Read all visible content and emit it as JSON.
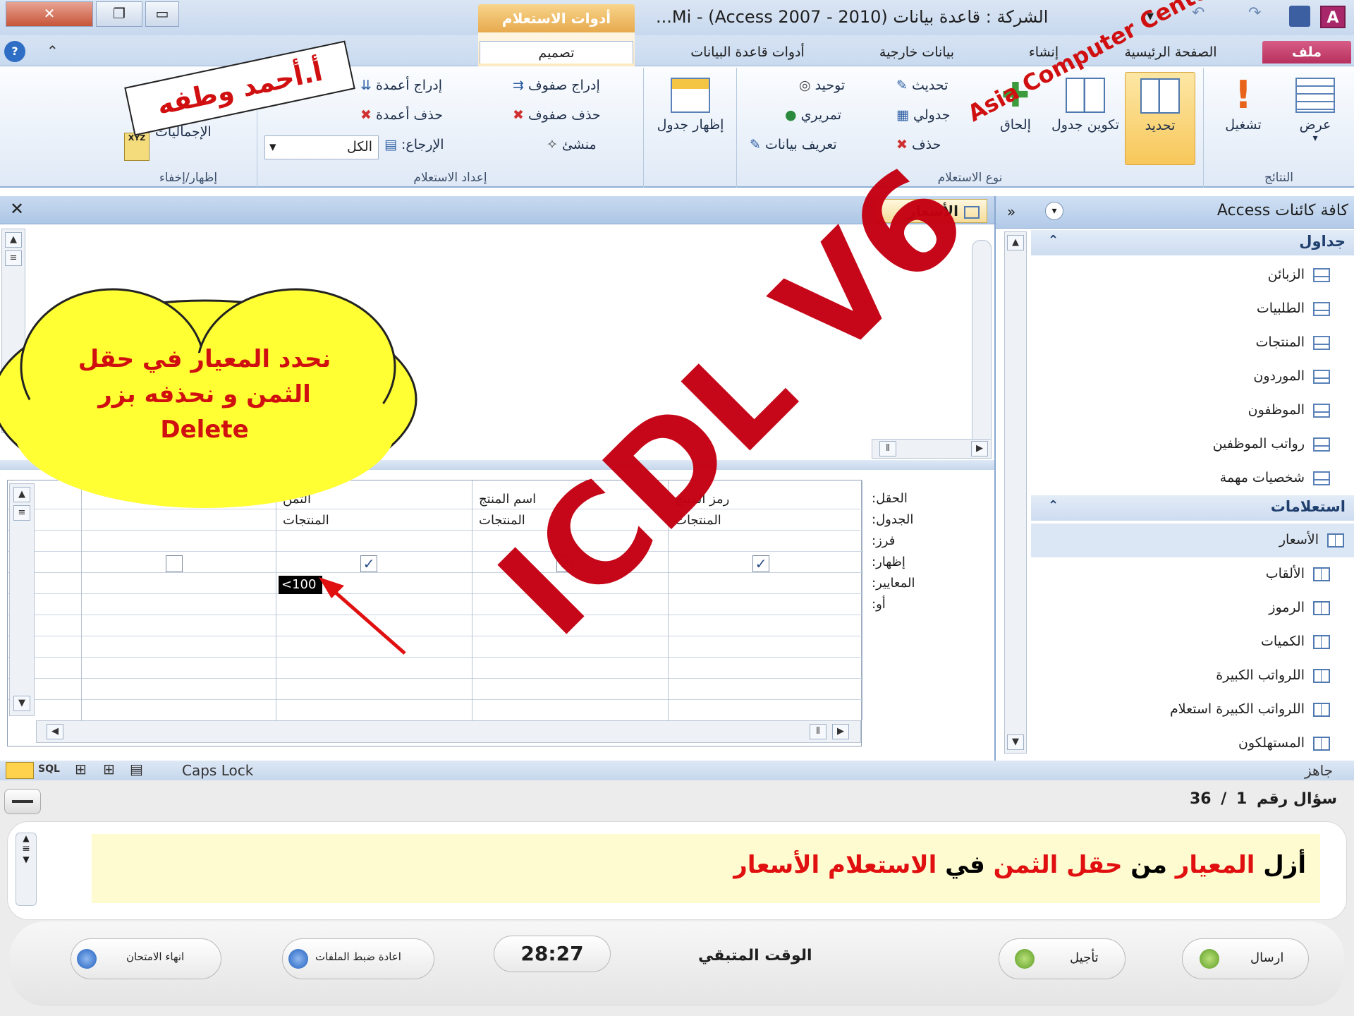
{
  "window": {
    "title": "الشركة : قاعدة بيانات (Access 2007 - 2010) - Mi...",
    "context_tab_header": "أدوات الاستعلام"
  },
  "tabs": {
    "file": "ملف",
    "home": "الصفحة الرئيسية",
    "create": "إنشاء",
    "external": "بيانات خارجية",
    "dbtools": "أدوات قاعدة البيانات",
    "design": "تصميم"
  },
  "ribbon": {
    "results": {
      "label": "النتائج",
      "view": "عرض",
      "run": "تشغيل"
    },
    "query_type": {
      "label": "نوع الاستعلام",
      "select": "تحديد",
      "make_table": "تكوين جدول",
      "append": "إلحاق",
      "update": "تحديث",
      "crosstab": "جدولي",
      "delete": "حذف",
      "union": "توحيد",
      "passthrough": "تمريري",
      "data_def": "تعريف بيانات"
    },
    "show_table": "إظهار جدول",
    "setup": {
      "label": "إعداد الاستعلام",
      "insert_rows": "إدراج صفوف",
      "delete_rows": "حذف صفوف",
      "builder": "منشئ",
      "insert_cols": "إدراج أعمدة",
      "delete_cols": "حذف أعمدة",
      "return_label": "الإرجاع:",
      "return_value": "الكل"
    },
    "showhide": {
      "label": "إظهار/إخفاء",
      "totals": "الإجماليات"
    }
  },
  "doc_tab": {
    "title": "الأسعار"
  },
  "nav": {
    "header": "كافة كائنات Access",
    "tables_label": "جداول",
    "tables": [
      "الزبائن",
      "الطلبيات",
      "المنتجات",
      "الموردون",
      "الموظفون",
      "رواتب الموظفين",
      "شخصيات مهمة"
    ],
    "queries_label": "استعلامات",
    "queries": [
      "الأسعار",
      "الألقاب",
      "الرموز",
      "الكميات",
      "اللرواتب الكبيرة",
      "اللرواتب الكبيرة استعلام",
      "المستهلكون"
    ]
  },
  "grid": {
    "row_labels": [
      "الحقل:",
      "الجدول:",
      "فرز:",
      "إظهار:",
      "المعايير:",
      "أو:"
    ],
    "columns": [
      {
        "field": "رمز المنتج",
        "table": "المنتجات",
        "show": true,
        "criteria": ""
      },
      {
        "field": "اسم المنتج",
        "table": "المنتجات",
        "show": true,
        "criteria": ""
      },
      {
        "field": "الثمن",
        "table": "المنتجات",
        "show": true,
        "criteria": "<100"
      },
      {
        "field": "",
        "table": "",
        "show": false,
        "criteria": ""
      }
    ]
  },
  "status": {
    "left": "جاهز",
    "caps": "Caps Lock",
    "sql": "SQL"
  },
  "overlay": {
    "watermark": "ICDL V6",
    "asia": "Asia Computer Center",
    "author": "أ.أحمد وطفه",
    "cloud_lines": [
      "نحدد المعيار في حقل",
      "الثمن و نحذفه بزر",
      "Delete"
    ]
  },
  "exam": {
    "q_label": "سؤال رقم",
    "q_current": "1",
    "q_total": "36",
    "q_sep": "/",
    "question_parts": [
      {
        "t": "أزل ",
        "c": "#000000"
      },
      {
        "t": "المعيار",
        "c": "#e01010"
      },
      {
        "t": " من ",
        "c": "#000000"
      },
      {
        "t": "حقل الثمن",
        "c": "#e01010"
      },
      {
        "t": " في ",
        "c": "#000000"
      },
      {
        "t": "الاستعلام الأسعار",
        "c": "#e01010"
      }
    ],
    "send": "ارسال",
    "defer": "تأجيل",
    "time_label": "الوقت المتبقي",
    "time_value": "28:27",
    "reset": "اعادة ضبط الملفات",
    "end": "انهاء الامتحان"
  },
  "colors": {
    "accent_red": "#cc0000",
    "highlight_yellow": "#fffbd0",
    "cloud_yellow": "#ffff33"
  }
}
